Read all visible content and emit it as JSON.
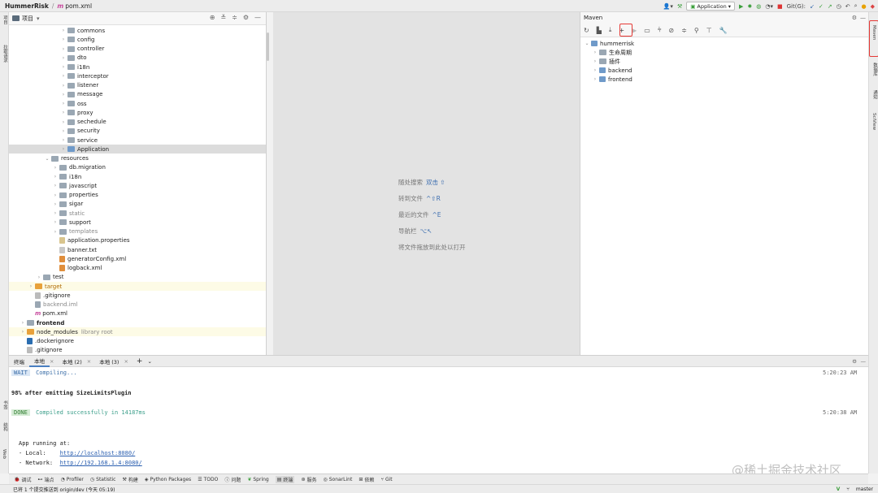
{
  "titlebar": {
    "project": "HummerRisk",
    "file": "pom.xml",
    "run_config": "Application",
    "git_label": "Git(G):"
  },
  "left_strip": {
    "top_items": [
      "项目",
      "拉取请求"
    ],
    "bottom_items": [
      "书签",
      "结构",
      "Web"
    ]
  },
  "right_strip": {
    "items": [
      "Maven",
      "数据库",
      "通知",
      "SciView"
    ]
  },
  "project_panel": {
    "title": "项目",
    "tree": [
      {
        "label": "commons",
        "depth": 6,
        "icon": "folder",
        "arrow": "›"
      },
      {
        "label": "config",
        "depth": 6,
        "icon": "folder",
        "arrow": "›"
      },
      {
        "label": "controller",
        "depth": 6,
        "icon": "folder",
        "arrow": "›"
      },
      {
        "label": "dto",
        "depth": 6,
        "icon": "folder",
        "arrow": "›"
      },
      {
        "label": "i18n",
        "depth": 6,
        "icon": "folder",
        "arrow": "›"
      },
      {
        "label": "interceptor",
        "depth": 6,
        "icon": "folder",
        "arrow": "›"
      },
      {
        "label": "listener",
        "depth": 6,
        "icon": "folder",
        "arrow": "›"
      },
      {
        "label": "message",
        "depth": 6,
        "icon": "folder",
        "arrow": "›"
      },
      {
        "label": "oss",
        "depth": 6,
        "icon": "folder",
        "arrow": "›"
      },
      {
        "label": "proxy",
        "depth": 6,
        "icon": "folder",
        "arrow": "›"
      },
      {
        "label": "sechedule",
        "depth": 6,
        "icon": "folder",
        "arrow": "›"
      },
      {
        "label": "security",
        "depth": 6,
        "icon": "folder",
        "arrow": "›"
      },
      {
        "label": "service",
        "depth": 6,
        "icon": "folder",
        "arrow": "›"
      },
      {
        "label": "Application",
        "depth": 6,
        "icon": "app",
        "arrow": "›",
        "selected": true
      },
      {
        "label": "resources",
        "depth": 4,
        "icon": "folder",
        "arrow": "⌄"
      },
      {
        "label": "db.migration",
        "depth": 5,
        "icon": "folder",
        "arrow": "›"
      },
      {
        "label": "i18n",
        "depth": 5,
        "icon": "folder",
        "arrow": "›"
      },
      {
        "label": "javascript",
        "depth": 5,
        "icon": "folder",
        "arrow": "›"
      },
      {
        "label": "properties",
        "depth": 5,
        "icon": "folder",
        "arrow": "›"
      },
      {
        "label": "sigar",
        "depth": 5,
        "icon": "folder",
        "arrow": "›"
      },
      {
        "label": "static",
        "depth": 5,
        "icon": "folder",
        "arrow": "›",
        "gray": true
      },
      {
        "label": "support",
        "depth": 5,
        "icon": "folder",
        "arrow": "›"
      },
      {
        "label": "templates",
        "depth": 5,
        "icon": "folder",
        "arrow": "›",
        "gray": true
      },
      {
        "label": "application.properties",
        "depth": 5,
        "icon": "file",
        "arrow": ""
      },
      {
        "label": "banner.txt",
        "depth": 5,
        "icon": "txt",
        "arrow": ""
      },
      {
        "label": "generatorConfig.xml",
        "depth": 5,
        "icon": "xml",
        "arrow": ""
      },
      {
        "label": "logback.xml",
        "depth": 5,
        "icon": "xml",
        "arrow": ""
      },
      {
        "label": "test",
        "depth": 3,
        "icon": "folder",
        "arrow": "›"
      },
      {
        "label": "target",
        "depth": 2,
        "icon": "orange",
        "arrow": "›",
        "highlight": true
      },
      {
        "label": ".gitignore",
        "depth": 2,
        "icon": "git",
        "arrow": ""
      },
      {
        "label": "backend.iml",
        "depth": 2,
        "icon": "iml",
        "arrow": "",
        "gray": true
      },
      {
        "label": "pom.xml",
        "depth": 2,
        "icon": "pom",
        "arrow": ""
      },
      {
        "label": "frontend",
        "depth": 1,
        "icon": "folder",
        "arrow": "›",
        "bold": true
      },
      {
        "label": "node_modules",
        "depth": 1,
        "icon": "orange",
        "arrow": "›",
        "suffix": "library root",
        "highlight": true
      },
      {
        "label": ".dockerignore",
        "depth": 1,
        "icon": "dock",
        "arrow": ""
      },
      {
        "label": ".gitignore",
        "depth": 1,
        "icon": "git",
        "arrow": ""
      }
    ]
  },
  "editor_hints": [
    {
      "text": "随处搜索",
      "key": "双击 ⇧"
    },
    {
      "text": "转到文件",
      "key": "^⇧R"
    },
    {
      "text": "最近的文件",
      "key": "^E"
    },
    {
      "text": "导航栏",
      "key": "⌥↖"
    },
    {
      "text": "将文件拖放到此处以打开",
      "key": ""
    }
  ],
  "maven": {
    "title": "Maven",
    "root": "hummerrisk",
    "children": [
      "生命周期",
      "插件",
      "backend",
      "frontend"
    ]
  },
  "terminal": {
    "tabs": [
      "终端",
      "本地",
      "本地 (2)",
      "本地 (3)"
    ],
    "lines": [
      {
        "tag": "WAIT",
        "text": "Compiling...",
        "time": "5:20:23 AM"
      },
      {
        "text": "98% after emitting SizeLimitsPlugin"
      },
      {
        "tag": "DONE",
        "text": "Compiled successfully in 14187ms",
        "time": "5:20:38 AM"
      },
      {
        "text": "App running at:"
      },
      {
        "label": "- Local:   ",
        "url": "http://localhost:8080/"
      },
      {
        "label": "- Network: ",
        "url": "http://192.168.1.4:8080/"
      }
    ]
  },
  "bottom_tools": [
    "调试",
    "端点",
    "Profiler",
    "Statistic",
    "构建",
    "Python Packages",
    "TODO",
    "问题",
    "Spring",
    "终端",
    "服务",
    "SonarLint",
    "依赖",
    "Git"
  ],
  "status": {
    "message": "已将 1 个提交推送到 origin/dev (今天 05:19)",
    "branch": "master"
  },
  "watermark": "@稀土掘金技术社区"
}
